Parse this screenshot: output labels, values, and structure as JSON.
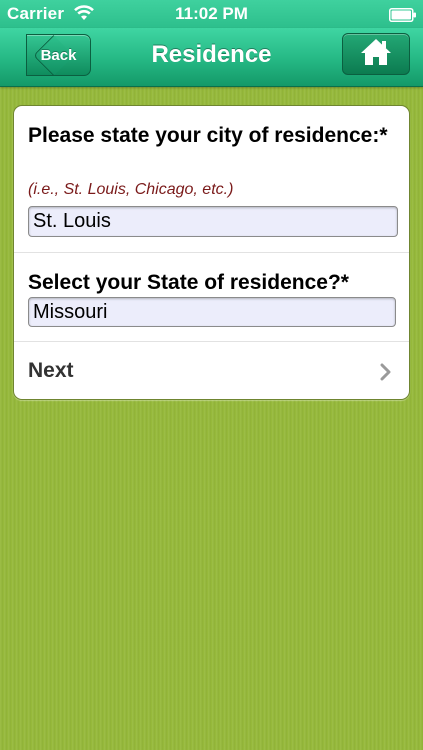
{
  "status_bar": {
    "carrier": "Carrier",
    "time": "11:02 PM",
    "icons": [
      "wifi-icon",
      "battery-icon"
    ]
  },
  "nav": {
    "back_label": "Back",
    "title": "Residence",
    "home_icon": "home-icon"
  },
  "form": {
    "city": {
      "label": "Please state your city of residence:*",
      "hint": "(i.e., St. Louis, Chicago, etc.)",
      "value": "St. Louis"
    },
    "state": {
      "label": "Select your State of residence?*",
      "value": "Missouri"
    },
    "next_label": "Next"
  },
  "colors": {
    "nav_green": "#25b884",
    "background_green": "#96b93b",
    "hint_red": "#7a1a1a",
    "field_fill": "#ecedfb"
  }
}
